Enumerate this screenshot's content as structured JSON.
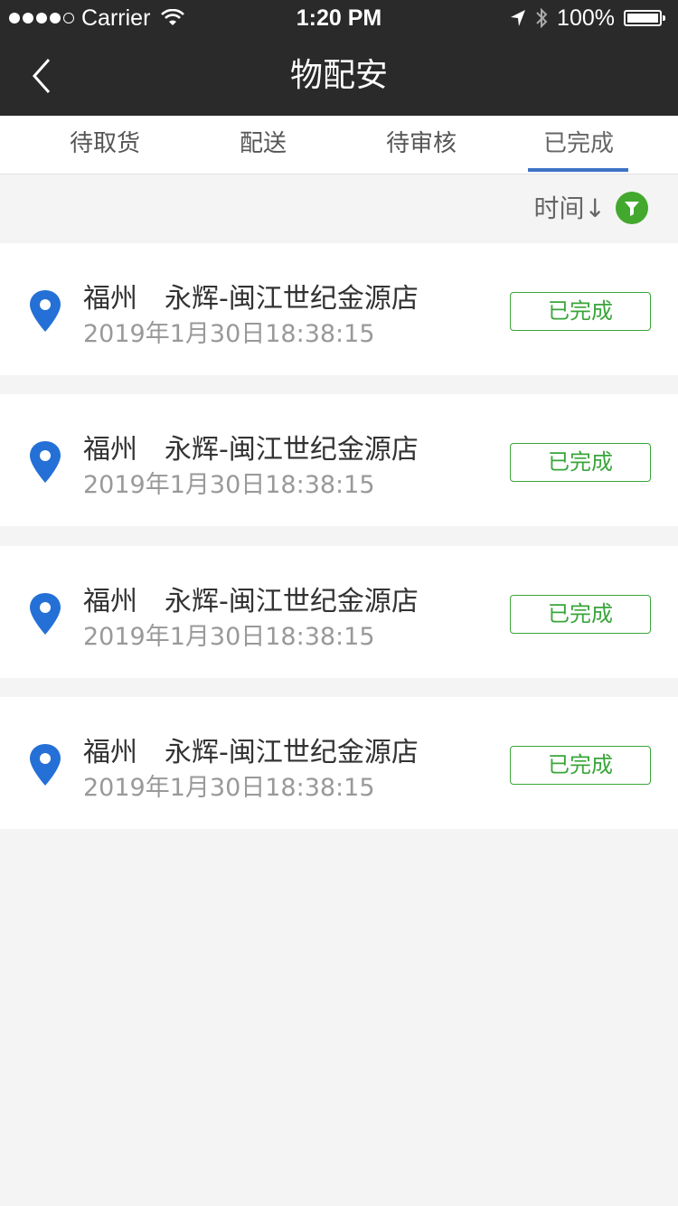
{
  "status_bar": {
    "carrier": "Carrier",
    "time": "1:20 PM",
    "battery": "100%"
  },
  "nav": {
    "title": "物配安",
    "back_icon": "chevron-left-icon"
  },
  "tabs": [
    {
      "label": "待取货",
      "active": false
    },
    {
      "label": "配送",
      "active": false
    },
    {
      "label": "待审核",
      "active": false
    },
    {
      "label": "已完成",
      "active": true
    }
  ],
  "sort": {
    "label": "时间↓",
    "filter_icon": "filter-icon",
    "filter_color": "#43a82e"
  },
  "colors": {
    "accent": "#3e73c6",
    "status_green": "#3aa53a",
    "pin_blue": "#2470d6",
    "header_bg": "#2a2a2a"
  },
  "orders": [
    {
      "store": "福州　永辉-闽江世纪金源店",
      "time": "2019年1月30日18:38:15",
      "status": "已完成"
    },
    {
      "store": "福州　永辉-闽江世纪金源店",
      "time": "2019年1月30日18:38:15",
      "status": "已完成"
    },
    {
      "store": "福州　永辉-闽江世纪金源店",
      "time": "2019年1月30日18:38:15",
      "status": "已完成"
    },
    {
      "store": "福州　永辉-闽江世纪金源店",
      "time": "2019年1月30日18:38:15",
      "status": "已完成"
    }
  ]
}
